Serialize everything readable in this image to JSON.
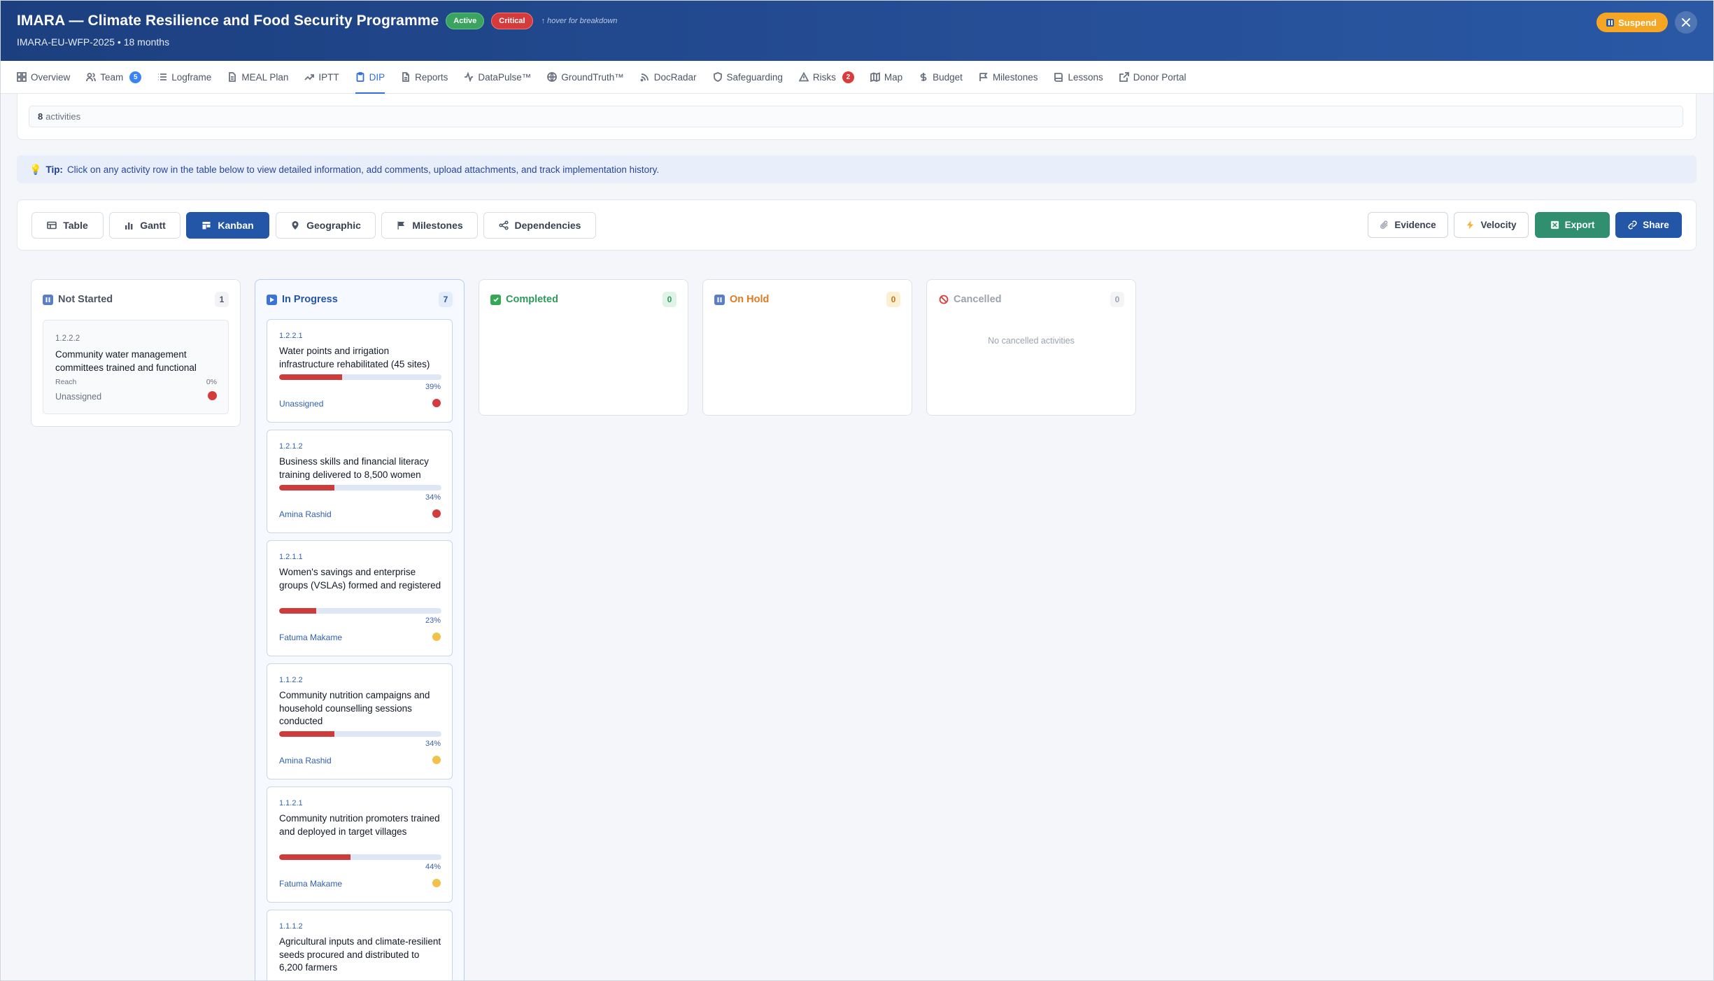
{
  "header": {
    "title": "IMARA — Climate Resilience and Food Security Programme",
    "status_badge": "Active",
    "risk_badge": "Critical",
    "hover_hint": "↑ hover for breakdown",
    "subtitle": "IMARA-EU-WFP-2025 • 18 months",
    "suspend_label": "Suspend",
    "close_icon": "close-icon"
  },
  "tabs": [
    {
      "label": "Overview",
      "icon": "grid-icon"
    },
    {
      "label": "Team",
      "icon": "users-icon",
      "count": "5"
    },
    {
      "label": "Logframe",
      "icon": "list-icon"
    },
    {
      "label": "MEAL Plan",
      "icon": "document-icon"
    },
    {
      "label": "IPTT",
      "icon": "trend-icon"
    },
    {
      "label": "DIP",
      "icon": "clipboard-icon",
      "active": true
    },
    {
      "label": "Reports",
      "icon": "file-icon"
    },
    {
      "label": "DataPulse™",
      "icon": "pulse-icon"
    },
    {
      "label": "GroundTruth™",
      "icon": "globe-icon"
    },
    {
      "label": "DocRadar",
      "icon": "radar-icon"
    },
    {
      "label": "Safeguarding",
      "icon": "shield-icon"
    },
    {
      "label": "Risks",
      "icon": "warning-icon",
      "count": "2"
    },
    {
      "label": "Map",
      "icon": "map-icon"
    },
    {
      "label": "Budget",
      "icon": "dollar-icon"
    },
    {
      "label": "Milestones",
      "icon": "flag-icon"
    },
    {
      "label": "Lessons",
      "icon": "book-icon"
    },
    {
      "label": "Donor Portal",
      "icon": "external-link-icon"
    }
  ],
  "activities": {
    "count": "8",
    "label": "activities"
  },
  "tip": {
    "label": "Tip:",
    "text": "Click on any activity row in the table below to view detailed information, add comments, upload attachments, and track implementation history."
  },
  "views": [
    "Table",
    "Gantt",
    "Kanban",
    "Geographic",
    "Milestones",
    "Dependencies"
  ],
  "active_view": "Kanban",
  "actions": {
    "evidence": "Evidence",
    "velocity": "Velocity",
    "export": "Export",
    "share": "Share"
  },
  "kanban": {
    "not_started": {
      "title": "Not Started",
      "count": "1",
      "cards": [
        {
          "code": "1.2.2.2",
          "name": "Community water management committees trained and functional",
          "metric": "Reach",
          "percent": "0%",
          "assignee": "Unassigned",
          "status": "red"
        }
      ]
    },
    "in_progress": {
      "title": "In Progress",
      "count": "7",
      "cards": [
        {
          "code": "1.2.2.1",
          "name": "Water points and irrigation infrastructure rehabilitated (45 sites)",
          "progress": 0.39,
          "percent": "39%",
          "assignee": "Unassigned",
          "status": "red"
        },
        {
          "code": "1.2.1.2",
          "name": "Business skills and financial literacy training delivered to 8,500 women",
          "progress": 0.34,
          "percent": "34%",
          "assignee": "Amina Rashid",
          "status": "red"
        },
        {
          "code": "1.2.1.1",
          "name": "Women's savings and enterprise groups (VSLAs) formed and registered",
          "progress": 0.23,
          "percent": "23%",
          "assignee": "Fatuma Makame",
          "status": "yellow"
        },
        {
          "code": "1.1.2.2",
          "name": "Community nutrition campaigns and household counselling sessions conducted",
          "progress": 0.34,
          "percent": "34%",
          "assignee": "Amina Rashid",
          "status": "yellow"
        },
        {
          "code": "1.1.2.1",
          "name": "Community nutrition promoters trained and deployed in target villages",
          "progress": 0.44,
          "percent": "44%",
          "assignee": "Fatuma Makame",
          "status": "yellow"
        },
        {
          "code": "1.1.1.2",
          "name": "Agricultural inputs and climate-resilient seeds procured and distributed to 6,200 farmers"
        }
      ]
    },
    "completed": {
      "title": "Completed",
      "count": "0"
    },
    "on_hold": {
      "title": "On Hold",
      "count": "0"
    },
    "cancelled": {
      "title": "Cancelled",
      "count": "0",
      "empty_text": "No cancelled activities"
    }
  },
  "colors": {
    "header_bg": "#244c93",
    "active_tab": "#2f6fde",
    "kanban_active": "#2456a8",
    "export": "#2f8f6e",
    "progress_fill": "#cf3b3b",
    "status_red": "#d43c3c",
    "status_yellow": "#f2c24d",
    "completed": "#2e9a5a",
    "on_hold": "#e0791f"
  }
}
